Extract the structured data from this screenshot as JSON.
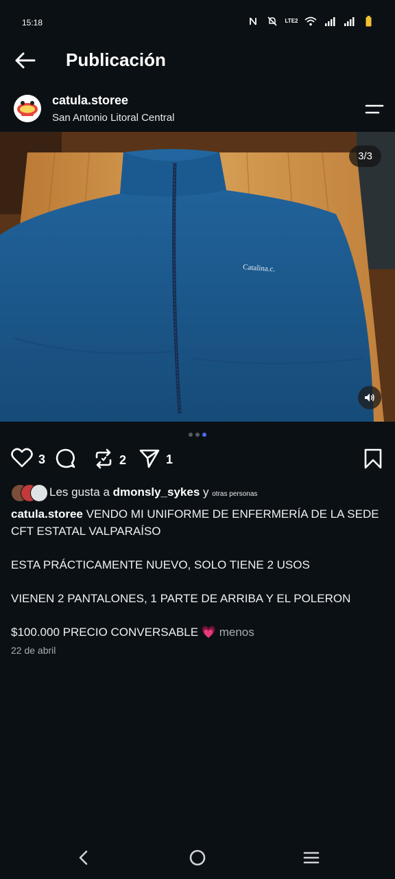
{
  "status_bar": {
    "time": "15:18",
    "network": "LTE2"
  },
  "header": {
    "title": "Publicación"
  },
  "post": {
    "username": "catula.storee",
    "location": "San Antonio Litoral Central",
    "image_counter": "3/3",
    "image_embroidery": "Catalina.c.",
    "actions": {
      "likes": "3",
      "reposts": "2",
      "shares": "1"
    },
    "likes": {
      "prefix": "Les gusta a",
      "user": "dmonsly_sykes",
      "joiner": "y",
      "others": "otras  personas"
    },
    "caption": {
      "user": "catula.storee",
      "line1": "VENDO MI UNIFORME DE ENFERMERÍA DE LA SEDE CFT ESTATAL VALPARAÍSO",
      "line2": "ESTA PRÁCTICAMENTE NUEVO, SOLO TIENE 2 USOS",
      "line3": "VIENEN 2 PANTALONES, 1 PARTE DE ARRIBA Y EL POLERON",
      "line4": "$100.000 PRECIO CONVERSABLE",
      "emoji": "💗",
      "less": "menos"
    },
    "date": "22 de abril"
  },
  "colors": {
    "background": "#0b1014",
    "fleece": "#1f5a8c",
    "accent_dot": "#4c6ef5",
    "heart_emoji": "#ff4f8b"
  },
  "icons": [
    "back-arrow-icon",
    "menu-icon",
    "heart-icon",
    "comment-icon",
    "repost-icon",
    "share-icon",
    "bookmark-icon",
    "volume-icon",
    "nav-back-icon",
    "nav-home-icon",
    "nav-recent-icon"
  ]
}
